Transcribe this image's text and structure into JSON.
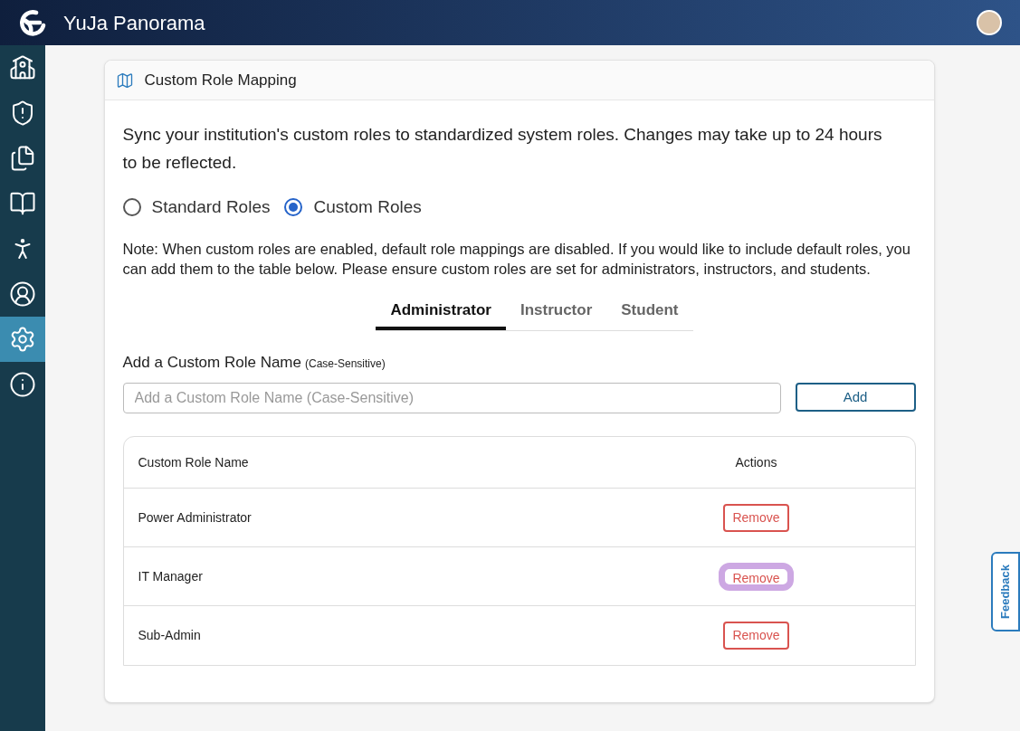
{
  "header": {
    "app_name": "YuJa Panorama"
  },
  "sidebar": {
    "items": [
      {
        "kind": "school",
        "selected": false
      },
      {
        "kind": "shield",
        "selected": false
      },
      {
        "kind": "files",
        "selected": false
      },
      {
        "kind": "book",
        "selected": false
      },
      {
        "kind": "accessibility",
        "selected": false
      },
      {
        "kind": "user",
        "selected": false
      },
      {
        "kind": "settings",
        "selected": true
      },
      {
        "kind": "info",
        "selected": false
      }
    ]
  },
  "card": {
    "title": "Custom Role Mapping",
    "description": "Sync your institution's custom roles to standardized system roles. Changes may take up to 24 hours to be reflected.",
    "role_options": [
      {
        "label": "Standard Roles",
        "selected": false
      },
      {
        "label": "Custom Roles",
        "selected": true
      }
    ],
    "note": "Note: When custom roles are enabled, default role mappings are disabled. If you would like to include default roles, you can add them to the table below. Please ensure custom roles are set for administrators, instructors, and students.",
    "tabs": [
      {
        "label": "Administrator",
        "selected": true
      },
      {
        "label": "Instructor",
        "selected": false
      },
      {
        "label": "Student",
        "selected": false
      }
    ],
    "add_label": "Add a Custom Role Name",
    "add_hint": "(Case-Sensitive)",
    "input": {
      "placeholder": "Add a Custom Role Name (Case-Sensitive)"
    },
    "add_button": "Add",
    "table": {
      "columns": [
        "Custom Role Name",
        "Actions"
      ],
      "rows": [
        {
          "name": "Power Administrator",
          "action": "Remove",
          "focused": false
        },
        {
          "name": "IT Manager",
          "action": "Remove",
          "focused": true
        },
        {
          "name": "Sub-Admin",
          "action": "Remove",
          "focused": false
        }
      ]
    }
  },
  "feedback": "Feedback"
}
